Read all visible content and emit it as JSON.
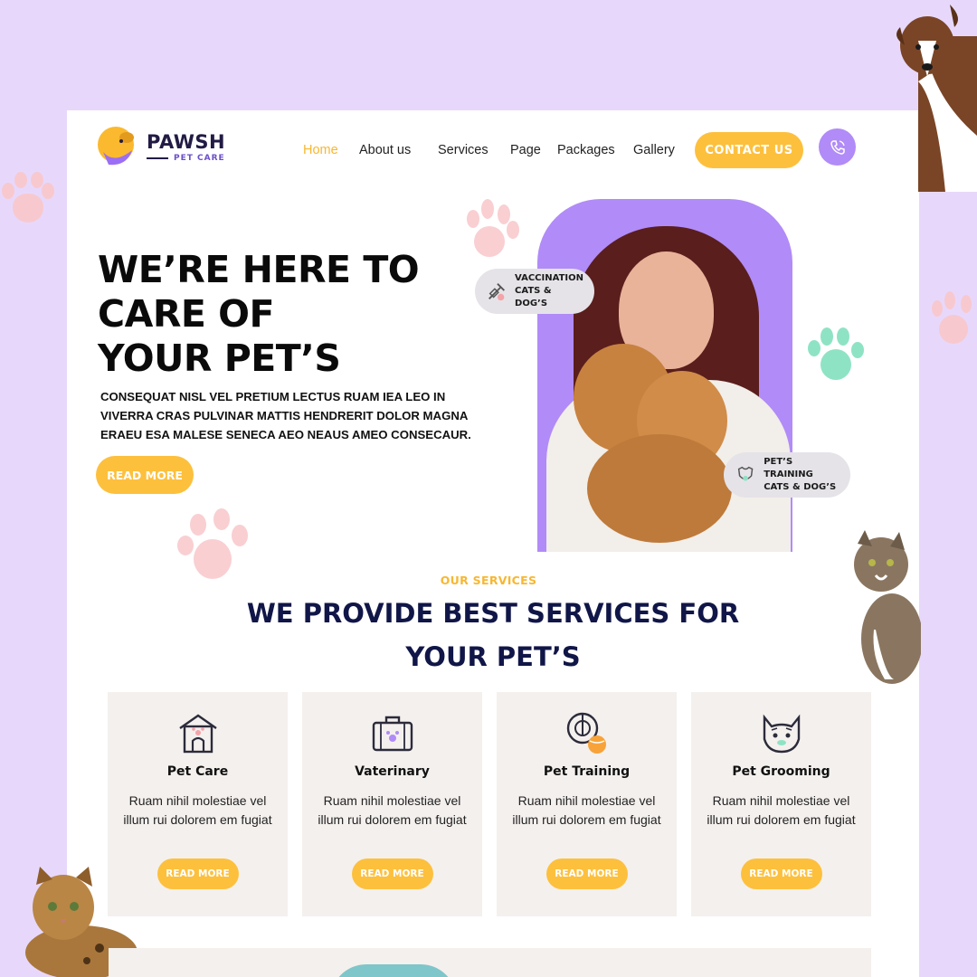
{
  "brand": {
    "name": "PAWSH",
    "tagline": "PET CARE"
  },
  "nav": {
    "items": [
      {
        "label": "Home",
        "active": true
      },
      {
        "label": "About us",
        "active": false
      },
      {
        "label": "Services",
        "active": false
      },
      {
        "label": "Page",
        "active": false
      },
      {
        "label": "Packages",
        "active": false
      },
      {
        "label": "Gallery",
        "active": false
      }
    ],
    "contact_label": "CONTACT US"
  },
  "hero": {
    "title_lines": [
      "WE’RE HERE TO",
      "CARE OF",
      "YOUR PET’S"
    ],
    "description": "CONSEQUAT NISL VEL PRETIUM LECTUS RUAM IEA LEO IN VIVERRA CRAS PULVINAR MATTIS HENDRERIT DOLOR MAGNA ERAEU ESA MALESE SENECA AEO NEAUS AMEO CONSECAUR.",
    "cta_label": "READ MORE",
    "badges": [
      {
        "line1": "VACCINATION",
        "line2": "CATS & DOG’S",
        "icon": "syringe-icon"
      },
      {
        "line1": "PET’S TRAINING",
        "line2": "CATS & DOG’S",
        "icon": "pet-shirt-icon"
      }
    ]
  },
  "services": {
    "eyebrow": "OUR SERVICES",
    "title_lines": [
      "WE PROVIDE BEST SERVICES FOR",
      "YOUR PET’S"
    ],
    "cards": [
      {
        "name": "Pet Care",
        "description": "Ruam nihil molestiae vel illum rui dolorem em fugiat",
        "button": "READ MORE",
        "icon": "pet-house-icon"
      },
      {
        "name": "Vaterinary",
        "description": "Ruam nihil molestiae vel illum rui dolorem em fugiat",
        "button": "READ MORE",
        "icon": "vet-kit-icon"
      },
      {
        "name": "Pet Training",
        "description": "Ruam nihil molestiae vel illum rui dolorem em fugiat",
        "button": "READ MORE",
        "icon": "training-ball-icon"
      },
      {
        "name": "Pet Grooming",
        "description": "Ruam nihil molestiae vel illum rui dolorem em fugiat",
        "button": "READ MORE",
        "icon": "cat-face-icon"
      }
    ]
  },
  "colors": {
    "background": "#e7d8fb",
    "accent": "#fdc03d",
    "purple": "#b18bf7",
    "navy": "#101647",
    "card": "#f4f0ee"
  }
}
